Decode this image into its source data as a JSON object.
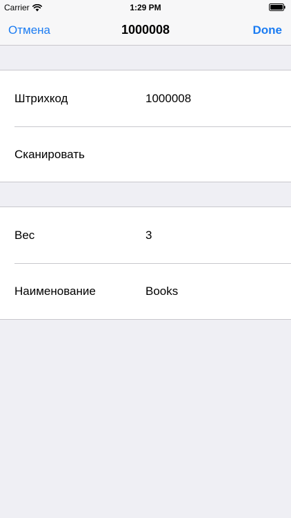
{
  "status_bar": {
    "carrier": "Carrier",
    "time": "1:29 PM",
    "wifi_icon": "wifi-icon",
    "battery_icon": "battery-icon"
  },
  "nav": {
    "left_label": "Отмена",
    "title": "1000008",
    "right_label": "Done",
    "accent_color": "#1b7cf2"
  },
  "sections": [
    {
      "rows": [
        {
          "label": "Штрихкод",
          "value": "1000008"
        },
        {
          "label": "Сканировать"
        }
      ]
    },
    {
      "rows": [
        {
          "label": "Вес",
          "value": "3"
        },
        {
          "label": "Наименование",
          "value": "Books"
        }
      ]
    }
  ]
}
